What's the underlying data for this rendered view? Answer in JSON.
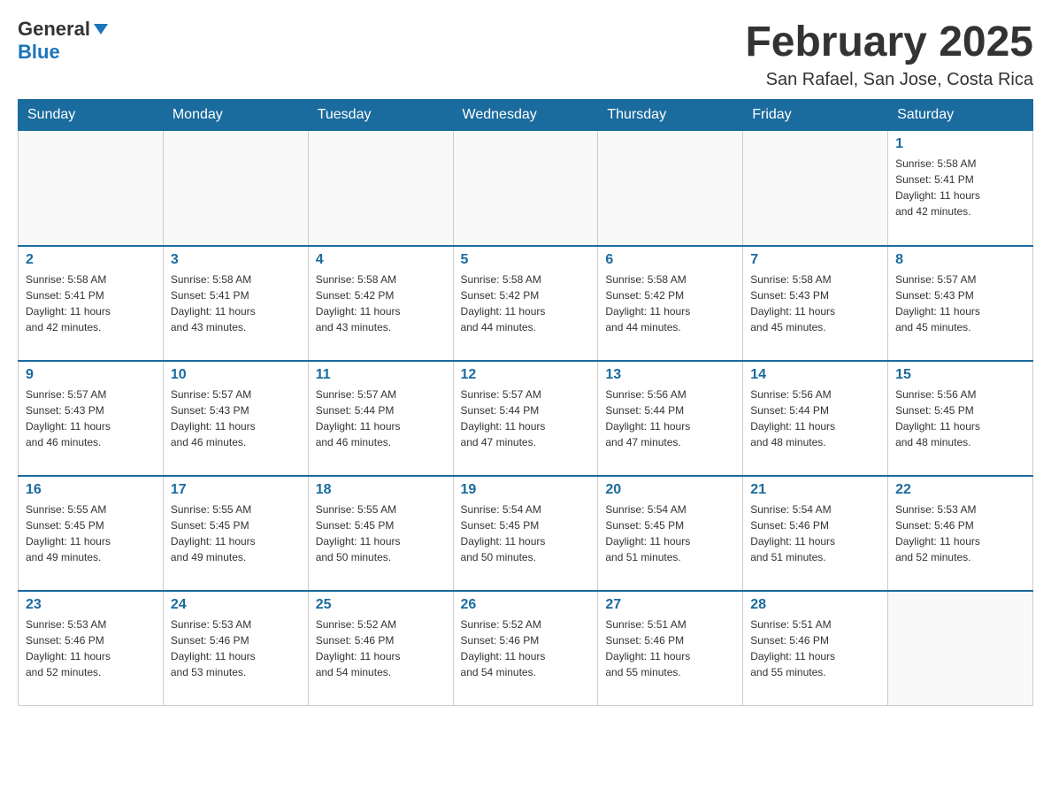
{
  "header": {
    "logo": {
      "general": "General",
      "blue": "Blue",
      "tagline": ""
    },
    "title": "February 2025",
    "location": "San Rafael, San Jose, Costa Rica"
  },
  "calendar": {
    "days_of_week": [
      "Sunday",
      "Monday",
      "Tuesday",
      "Wednesday",
      "Thursday",
      "Friday",
      "Saturday"
    ],
    "weeks": [
      [
        {
          "day": "",
          "info": ""
        },
        {
          "day": "",
          "info": ""
        },
        {
          "day": "",
          "info": ""
        },
        {
          "day": "",
          "info": ""
        },
        {
          "day": "",
          "info": ""
        },
        {
          "day": "",
          "info": ""
        },
        {
          "day": "1",
          "info": "Sunrise: 5:58 AM\nSunset: 5:41 PM\nDaylight: 11 hours\nand 42 minutes."
        }
      ],
      [
        {
          "day": "2",
          "info": "Sunrise: 5:58 AM\nSunset: 5:41 PM\nDaylight: 11 hours\nand 42 minutes."
        },
        {
          "day": "3",
          "info": "Sunrise: 5:58 AM\nSunset: 5:41 PM\nDaylight: 11 hours\nand 43 minutes."
        },
        {
          "day": "4",
          "info": "Sunrise: 5:58 AM\nSunset: 5:42 PM\nDaylight: 11 hours\nand 43 minutes."
        },
        {
          "day": "5",
          "info": "Sunrise: 5:58 AM\nSunset: 5:42 PM\nDaylight: 11 hours\nand 44 minutes."
        },
        {
          "day": "6",
          "info": "Sunrise: 5:58 AM\nSunset: 5:42 PM\nDaylight: 11 hours\nand 44 minutes."
        },
        {
          "day": "7",
          "info": "Sunrise: 5:58 AM\nSunset: 5:43 PM\nDaylight: 11 hours\nand 45 minutes."
        },
        {
          "day": "8",
          "info": "Sunrise: 5:57 AM\nSunset: 5:43 PM\nDaylight: 11 hours\nand 45 minutes."
        }
      ],
      [
        {
          "day": "9",
          "info": "Sunrise: 5:57 AM\nSunset: 5:43 PM\nDaylight: 11 hours\nand 46 minutes."
        },
        {
          "day": "10",
          "info": "Sunrise: 5:57 AM\nSunset: 5:43 PM\nDaylight: 11 hours\nand 46 minutes."
        },
        {
          "day": "11",
          "info": "Sunrise: 5:57 AM\nSunset: 5:44 PM\nDaylight: 11 hours\nand 46 minutes."
        },
        {
          "day": "12",
          "info": "Sunrise: 5:57 AM\nSunset: 5:44 PM\nDaylight: 11 hours\nand 47 minutes."
        },
        {
          "day": "13",
          "info": "Sunrise: 5:56 AM\nSunset: 5:44 PM\nDaylight: 11 hours\nand 47 minutes."
        },
        {
          "day": "14",
          "info": "Sunrise: 5:56 AM\nSunset: 5:44 PM\nDaylight: 11 hours\nand 48 minutes."
        },
        {
          "day": "15",
          "info": "Sunrise: 5:56 AM\nSunset: 5:45 PM\nDaylight: 11 hours\nand 48 minutes."
        }
      ],
      [
        {
          "day": "16",
          "info": "Sunrise: 5:55 AM\nSunset: 5:45 PM\nDaylight: 11 hours\nand 49 minutes."
        },
        {
          "day": "17",
          "info": "Sunrise: 5:55 AM\nSunset: 5:45 PM\nDaylight: 11 hours\nand 49 minutes."
        },
        {
          "day": "18",
          "info": "Sunrise: 5:55 AM\nSunset: 5:45 PM\nDaylight: 11 hours\nand 50 minutes."
        },
        {
          "day": "19",
          "info": "Sunrise: 5:54 AM\nSunset: 5:45 PM\nDaylight: 11 hours\nand 50 minutes."
        },
        {
          "day": "20",
          "info": "Sunrise: 5:54 AM\nSunset: 5:45 PM\nDaylight: 11 hours\nand 51 minutes."
        },
        {
          "day": "21",
          "info": "Sunrise: 5:54 AM\nSunset: 5:46 PM\nDaylight: 11 hours\nand 51 minutes."
        },
        {
          "day": "22",
          "info": "Sunrise: 5:53 AM\nSunset: 5:46 PM\nDaylight: 11 hours\nand 52 minutes."
        }
      ],
      [
        {
          "day": "23",
          "info": "Sunrise: 5:53 AM\nSunset: 5:46 PM\nDaylight: 11 hours\nand 52 minutes."
        },
        {
          "day": "24",
          "info": "Sunrise: 5:53 AM\nSunset: 5:46 PM\nDaylight: 11 hours\nand 53 minutes."
        },
        {
          "day": "25",
          "info": "Sunrise: 5:52 AM\nSunset: 5:46 PM\nDaylight: 11 hours\nand 54 minutes."
        },
        {
          "day": "26",
          "info": "Sunrise: 5:52 AM\nSunset: 5:46 PM\nDaylight: 11 hours\nand 54 minutes."
        },
        {
          "day": "27",
          "info": "Sunrise: 5:51 AM\nSunset: 5:46 PM\nDaylight: 11 hours\nand 55 minutes."
        },
        {
          "day": "28",
          "info": "Sunrise: 5:51 AM\nSunset: 5:46 PM\nDaylight: 11 hours\nand 55 minutes."
        },
        {
          "day": "",
          "info": ""
        }
      ]
    ]
  }
}
